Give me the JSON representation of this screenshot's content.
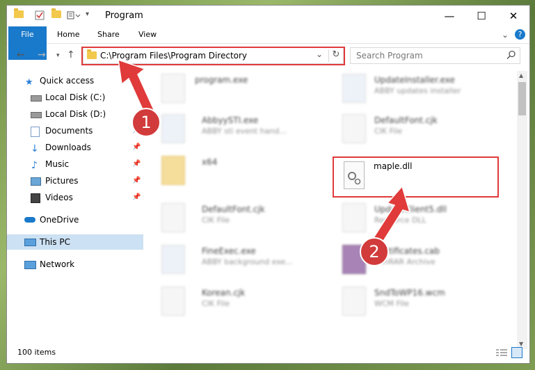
{
  "window": {
    "title": "Program",
    "controls": {
      "minimize": "—",
      "maximize": "☐",
      "close": "✕"
    }
  },
  "ribbon": {
    "tabs": [
      "File",
      "Home",
      "Share",
      "View"
    ]
  },
  "address": {
    "path": "C:\\Program Files\\Program Directory",
    "search_placeholder": "Search Program"
  },
  "sidebar": {
    "items": [
      {
        "label": "Quick access",
        "icon": "star-icon",
        "pinned": false
      },
      {
        "label": "Local Disk (C:)",
        "icon": "drive-icon",
        "pinned": false
      },
      {
        "label": "Local Disk (D:)",
        "icon": "drive-icon",
        "pinned": false
      },
      {
        "label": "Documents",
        "icon": "documents-icon",
        "pinned": true
      },
      {
        "label": "Downloads",
        "icon": "download-icon",
        "pinned": true
      },
      {
        "label": "Music",
        "icon": "music-icon",
        "pinned": true
      },
      {
        "label": "Pictures",
        "icon": "pictures-icon",
        "pinned": true
      },
      {
        "label": "Videos",
        "icon": "videos-icon",
        "pinned": true
      },
      {
        "label": "OneDrive",
        "icon": "cloud-icon",
        "pinned": false
      },
      {
        "label": "This PC",
        "icon": "pc-icon",
        "pinned": false
      },
      {
        "label": "Network",
        "icon": "network-icon",
        "pinned": false
      }
    ]
  },
  "files": [
    {
      "name": "program.exe",
      "sub": ""
    },
    {
      "name": "UpdateInstaller.exe",
      "sub": "ABBY updates installer"
    },
    {
      "name": "AbbyySTI.exe",
      "sub": "ABBY sti event hand..."
    },
    {
      "name": "DefaultFont.cjk",
      "sub": "CIK File"
    },
    {
      "name": "x64",
      "sub": ""
    },
    {
      "name": "maple.dll",
      "sub": ""
    },
    {
      "name": "DefaultFont.cjk",
      "sub": "CIK File"
    },
    {
      "name": "UpdateClient5.dll",
      "sub": "Resource DLL"
    },
    {
      "name": "FineExec.exe",
      "sub": "ABBY background exe..."
    },
    {
      "name": "Certificates.cab",
      "sub": "WinRAR Archive"
    },
    {
      "name": "Korean.cjk",
      "sub": "CIK File"
    },
    {
      "name": "SndToWP16.wcm",
      "sub": "WCM File"
    }
  ],
  "status": {
    "count": "100 items"
  },
  "annotations": [
    "1",
    "2"
  ]
}
